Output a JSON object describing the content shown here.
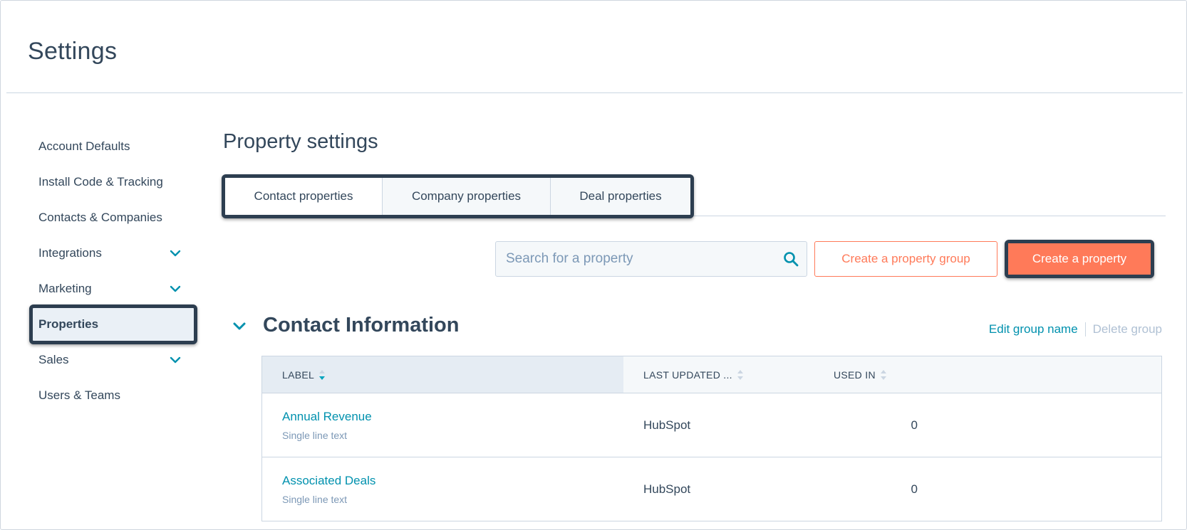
{
  "app": {
    "title": "Settings"
  },
  "sidebar": {
    "items": [
      {
        "label": "Account Defaults",
        "has_chevron": false
      },
      {
        "label": "Install Code & Tracking",
        "has_chevron": false
      },
      {
        "label": "Contacts & Companies",
        "has_chevron": false
      },
      {
        "label": "Integrations",
        "has_chevron": true
      },
      {
        "label": "Marketing",
        "has_chevron": true
      },
      {
        "label": "Properties",
        "has_chevron": false,
        "active": true
      },
      {
        "label": "Sales",
        "has_chevron": true
      },
      {
        "label": "Users & Teams",
        "has_chevron": false
      }
    ]
  },
  "main": {
    "title": "Property settings",
    "tabs": [
      {
        "label": "Contact properties",
        "selected": true
      },
      {
        "label": "Company properties",
        "selected": false
      },
      {
        "label": "Deal properties",
        "selected": false
      }
    ],
    "search": {
      "placeholder": "Search for a property",
      "value": ""
    },
    "buttons": {
      "create_group": "Create a property group",
      "create_property": "Create a property"
    },
    "group": {
      "title": "Contact Information",
      "edit_label": "Edit group name",
      "delete_label": "Delete group"
    },
    "table": {
      "columns": [
        "LABEL",
        "LAST UPDATED ...",
        "USED IN"
      ],
      "rows": [
        {
          "name": "Annual Revenue",
          "type": "Single line text",
          "updated_by": "HubSpot",
          "used_in": "0"
        },
        {
          "name": "Associated Deals",
          "type": "Single line text",
          "updated_by": "HubSpot",
          "used_in": "0"
        }
      ]
    }
  },
  "colors": {
    "text": "#33475b",
    "link": "#0091ae",
    "accent": "#ff7a59",
    "highlight_border": "#2d3e50",
    "muted": "#7c98b6"
  }
}
